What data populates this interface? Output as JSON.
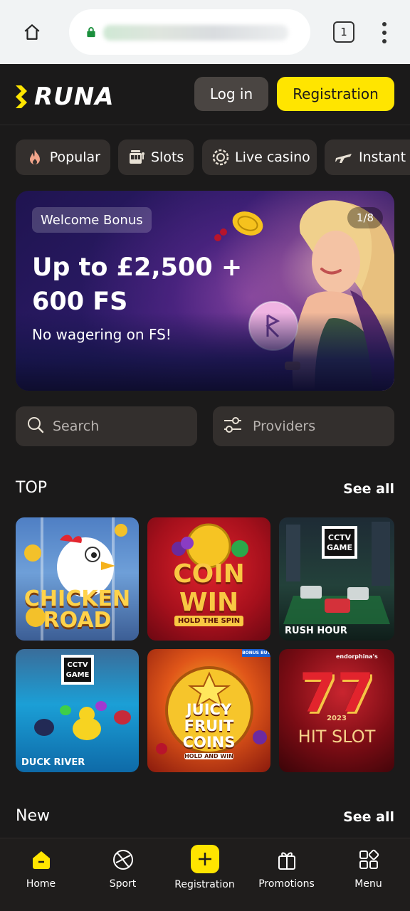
{
  "browser": {
    "tab_count": "1"
  },
  "header": {
    "logo_text": "RUNA",
    "login_label": "Log in",
    "register_label": "Registration"
  },
  "categories": [
    {
      "label": "Popular",
      "icon": "flame-icon"
    },
    {
      "label": "Slots",
      "icon": "slot-machine-icon"
    },
    {
      "label": "Live casino",
      "icon": "casino-chip-icon"
    },
    {
      "label": "Instant",
      "icon": "airplane-icon"
    }
  ],
  "banner": {
    "tag": "Welcome Bonus",
    "counter": "1/8",
    "title": "Up to £2,500 + 600 FS",
    "subtitle": "No wagering on FS!"
  },
  "search": {
    "placeholder": "Search"
  },
  "providers": {
    "label": "Providers"
  },
  "top": {
    "title": "TOP",
    "see_all": "See all",
    "games": [
      {
        "name": "CHICKEN ROAD"
      },
      {
        "name": "COIN WIN",
        "caption": "HOLD THE SPIN"
      },
      {
        "name": "CCTV GAME",
        "caption": "RUSH HOUR"
      },
      {
        "name": "CCTV GAME",
        "caption": "DUCK RIVER"
      },
      {
        "name": "JUICY FRUIT COINS",
        "caption": "HOLD AND WIN",
        "badge": "BONUS BUY"
      },
      {
        "name": "HIT SLOT",
        "year": "2023",
        "studio": "endorphina's"
      }
    ]
  },
  "new": {
    "title": "New",
    "see_all": "See all"
  },
  "bottom_nav": [
    {
      "label": "Home",
      "icon": "home-icon"
    },
    {
      "label": "Sport",
      "icon": "ball-icon"
    },
    {
      "label": "Registration",
      "icon": "plus-icon"
    },
    {
      "label": "Promotions",
      "icon": "gift-icon"
    },
    {
      "label": "Menu",
      "icon": "grid-menu-icon"
    }
  ],
  "colors": {
    "accent": "#ffe500",
    "background": "#1b1a1a",
    "surface": "#332f2d"
  }
}
